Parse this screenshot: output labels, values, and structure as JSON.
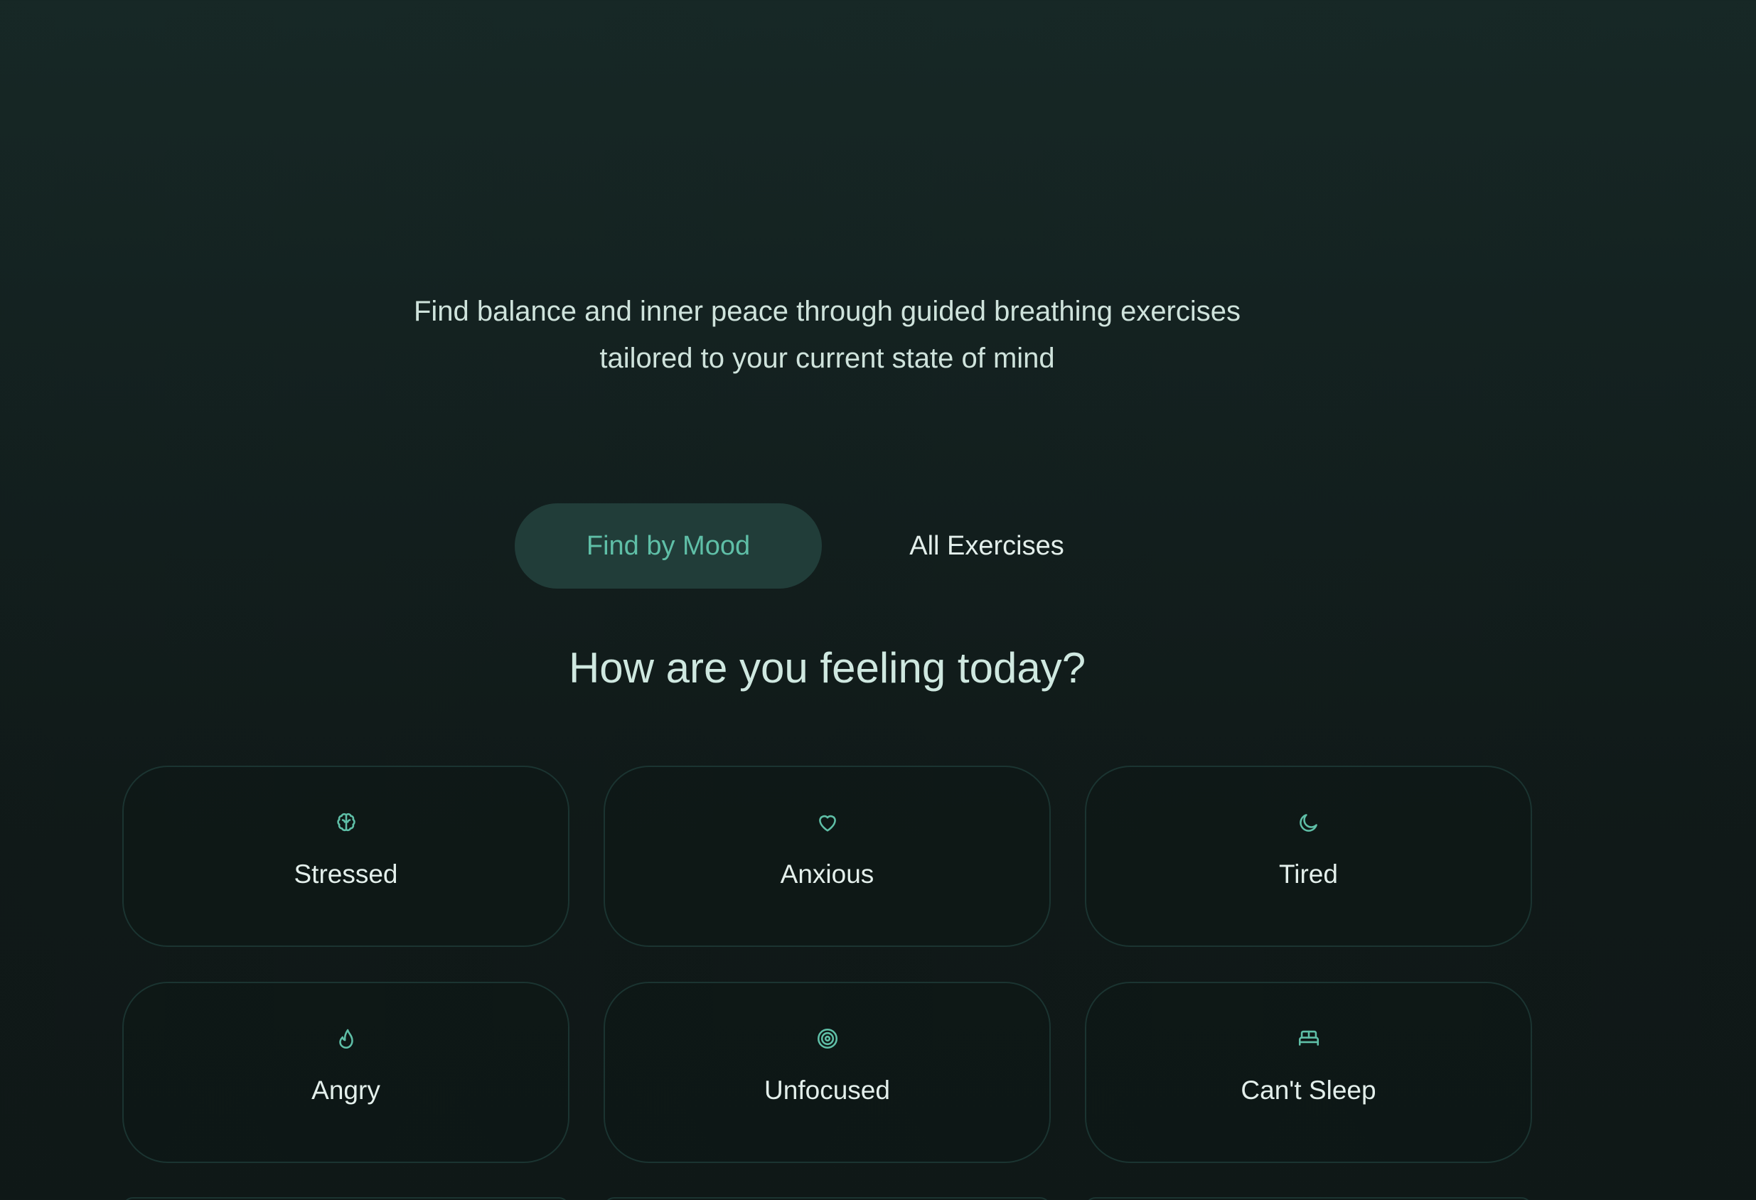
{
  "subtitle": {
    "line1": "Find balance and inner peace through guided breathing exercises",
    "line2": "tailored to your current state of mind"
  },
  "tabs": [
    {
      "label": "Find by Mood",
      "active": true
    },
    {
      "label": "All Exercises",
      "active": false
    }
  ],
  "heading": "How are you feeling today?",
  "moods": [
    {
      "label": "Stressed",
      "icon": "brain-icon"
    },
    {
      "label": "Anxious",
      "icon": "heart-icon"
    },
    {
      "label": "Tired",
      "icon": "moon-icon"
    },
    {
      "label": "Angry",
      "icon": "flame-icon"
    },
    {
      "label": "Unfocused",
      "icon": "target-icon"
    },
    {
      "label": "Can't Sleep",
      "icon": "bed-icon"
    }
  ],
  "colors": {
    "accent": "#5fbfa7",
    "text": "#e3efeb",
    "background": "#0f1817",
    "card_border": "#1b3431",
    "tab_active_bg": "#213d39"
  }
}
